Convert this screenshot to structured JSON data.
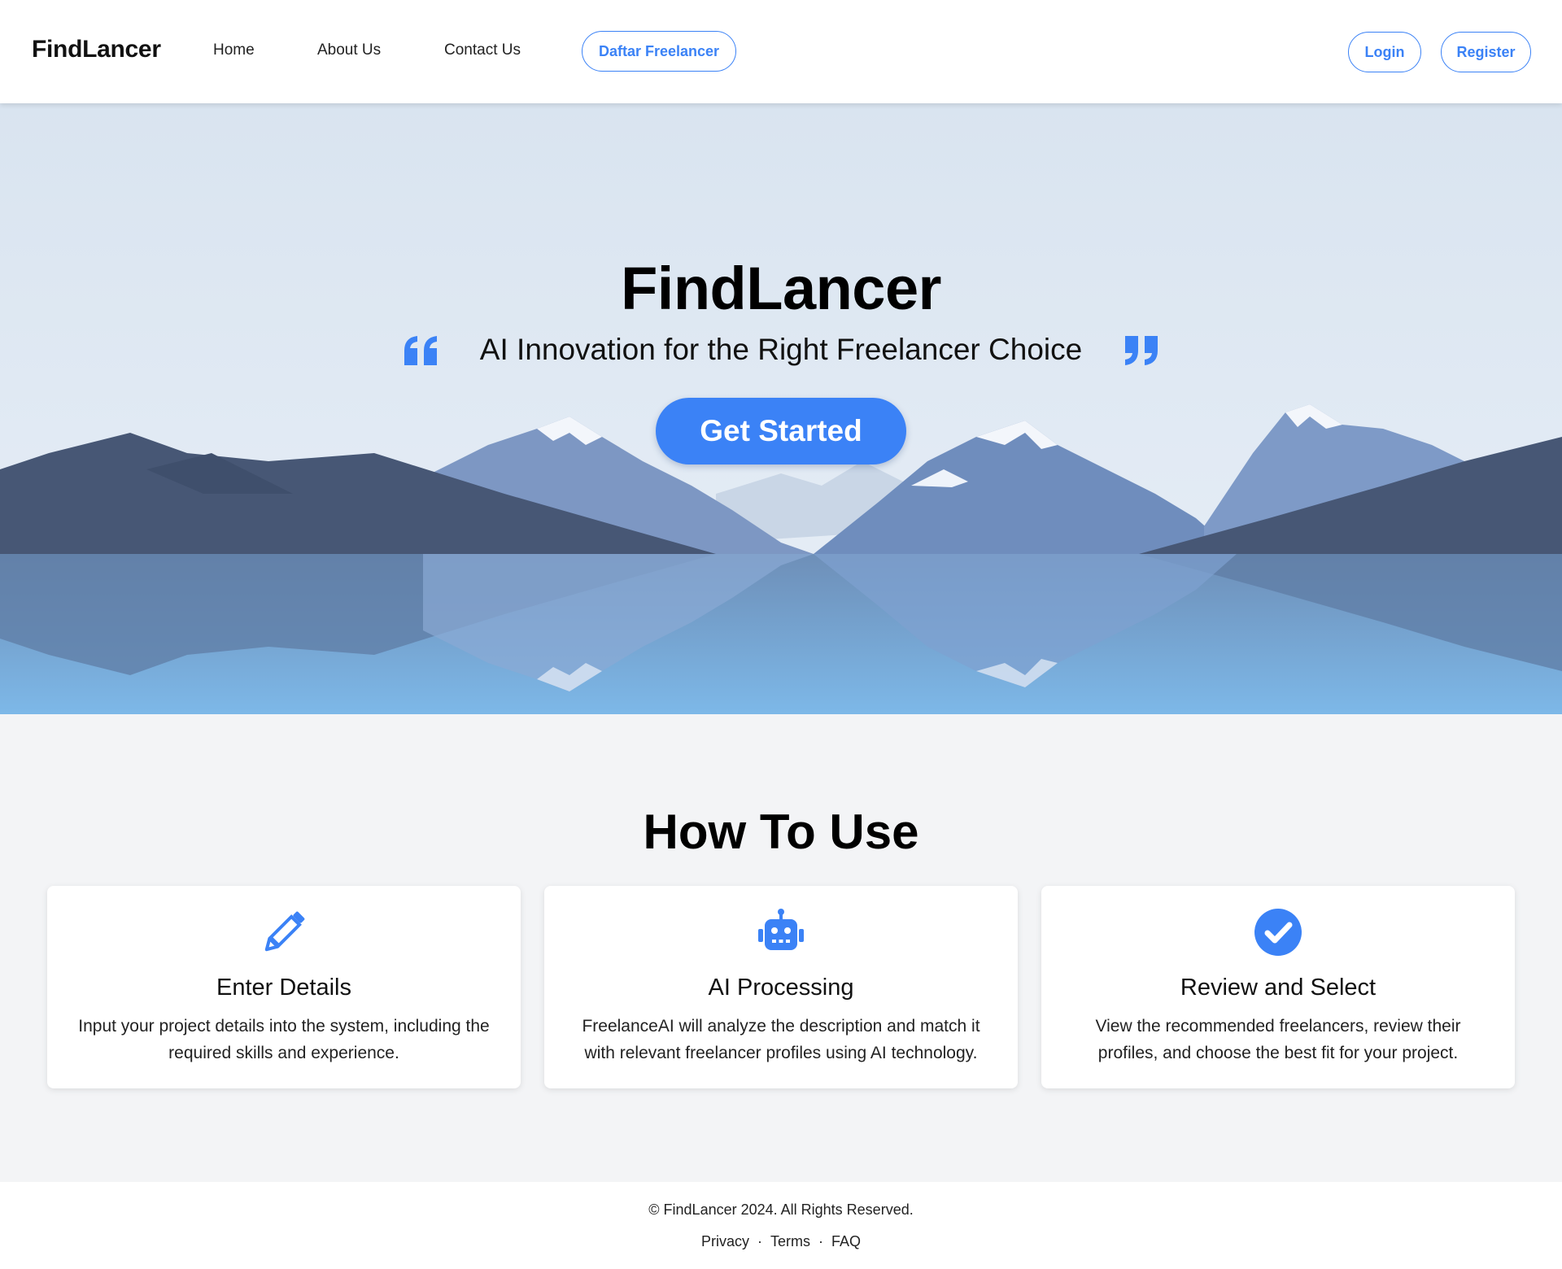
{
  "colors": {
    "accent": "#3b82f6",
    "page_bg": "#f3f4f6",
    "card_bg": "#ffffff"
  },
  "navbar": {
    "brand": "FindLancer",
    "links": [
      "Home",
      "About Us",
      "Contact Us"
    ],
    "daftar_label": "Daftar Freelancer",
    "login_label": "Login",
    "register_label": "Register"
  },
  "hero": {
    "title": "FindLancer",
    "subtitle": "AI Innovation for the Right Freelancer Choice",
    "cta_label": "Get Started",
    "left_icon": "quote-left-icon",
    "right_icon": "quote-right-icon"
  },
  "howto": {
    "title": "How To Use",
    "cards": [
      {
        "icon": "pencil-icon",
        "title": "Enter Details",
        "text": "Input your project details into the system, including the required skills and experience."
      },
      {
        "icon": "robot-icon",
        "title": "AI Processing",
        "text": "FreelanceAI will analyze the description and match it with relevant freelancer profiles using AI technology."
      },
      {
        "icon": "check-circle-icon",
        "title": "Review and Select",
        "text": "View the recommended freelancers, review their profiles, and choose the best fit for your project."
      }
    ]
  },
  "footer": {
    "copyright": "© FindLancer 2024. All Rights Reserved.",
    "links": [
      "Privacy",
      "Terms",
      "FAQ"
    ],
    "separator": "·"
  }
}
